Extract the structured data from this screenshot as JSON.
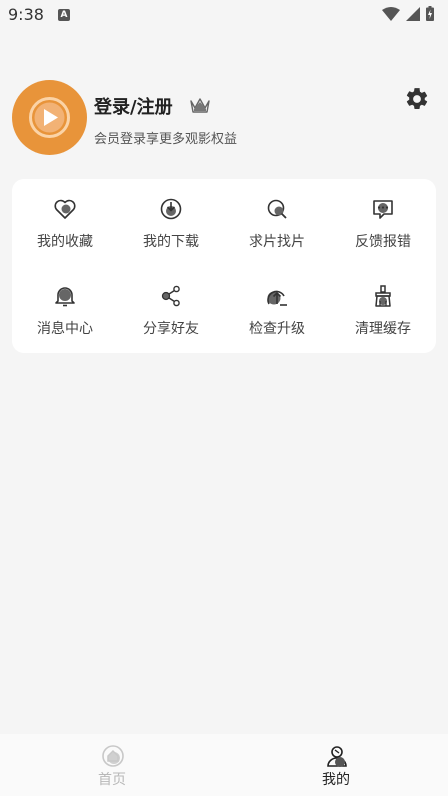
{
  "status_bar": {
    "time": "9:38",
    "notification_glyph": "A"
  },
  "profile": {
    "title": "登录/注册",
    "subtitle": "会员登录享更多观影权益",
    "avatar_color": "#e8943a"
  },
  "menu": [
    {
      "label": "我的收藏",
      "icon": "heart-icon"
    },
    {
      "label": "我的下载",
      "icon": "download-icon"
    },
    {
      "label": "求片找片",
      "icon": "search-icon"
    },
    {
      "label": "反馈报错",
      "icon": "feedback-icon"
    },
    {
      "label": "消息中心",
      "icon": "bell-icon"
    },
    {
      "label": "分享好友",
      "icon": "share-icon"
    },
    {
      "label": "检查升级",
      "icon": "upgrade-icon"
    },
    {
      "label": "清理缓存",
      "icon": "broom-icon"
    }
  ],
  "bottom_nav": [
    {
      "label": "首页",
      "icon": "home-icon",
      "active": false
    },
    {
      "label": "我的",
      "icon": "profile-icon",
      "active": true
    }
  ]
}
